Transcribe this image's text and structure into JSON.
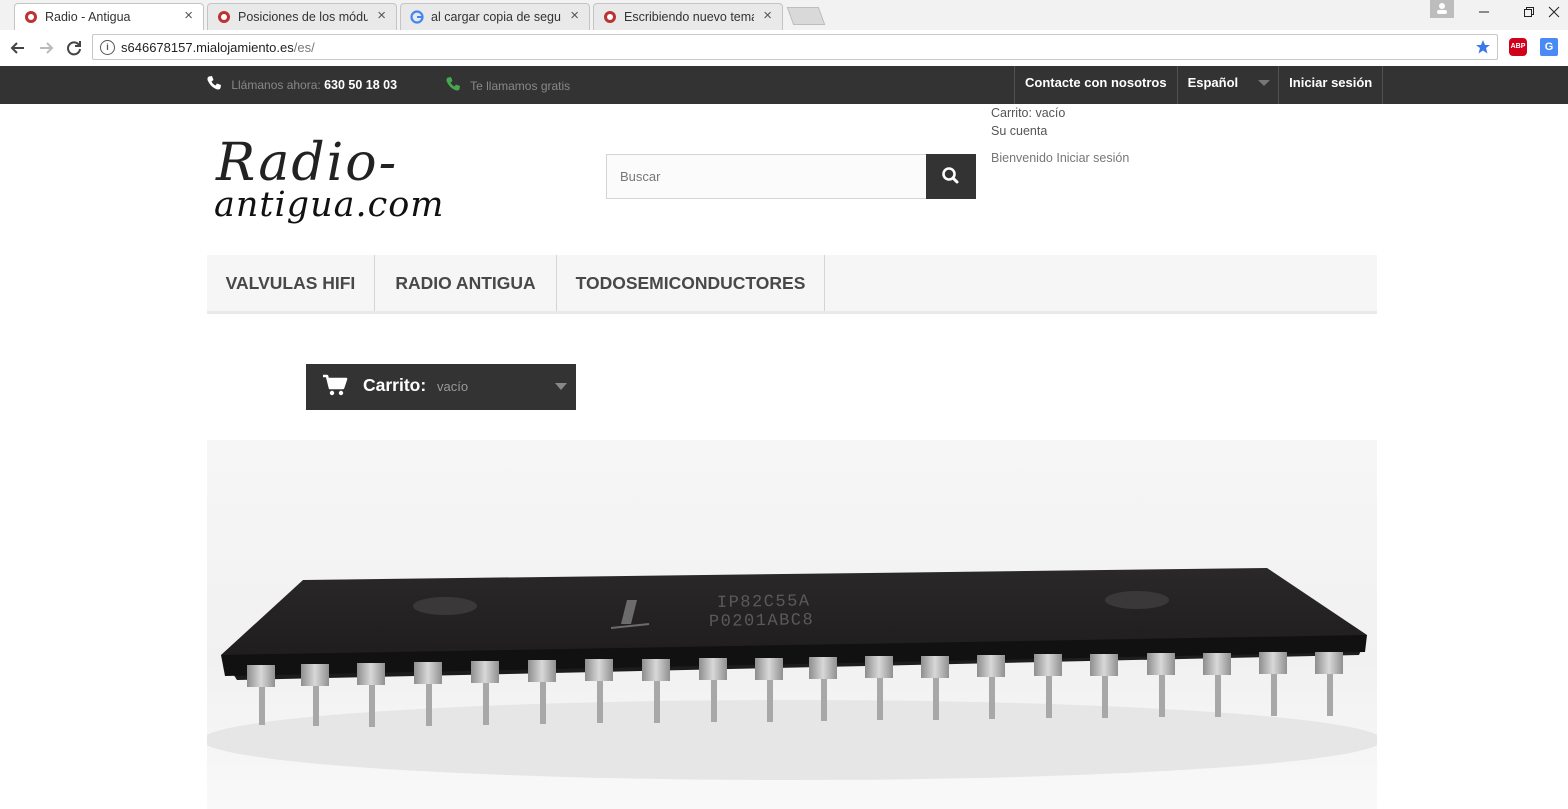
{
  "browser": {
    "tabs": [
      {
        "title": "Radio - Antigua",
        "active": true
      },
      {
        "title": "Posiciones de los módulos"
      },
      {
        "title": "al cargar copia de seguridad"
      },
      {
        "title": "Escribiendo nuevo tema"
      }
    ],
    "close_glyph": "×",
    "url_host": "s646678157.mialojamiento.es",
    "url_path": "/es/",
    "extensions": {
      "adblock": "ABP",
      "translate": "G"
    }
  },
  "topnav": {
    "call_label": "Llámanos ahora:",
    "phone": "630 50 18 03",
    "free_call": "Te llamamos gratis",
    "contact": "Contacte con nosotros",
    "language": "Español",
    "login": "Iniciar sesión"
  },
  "header": {
    "logo_line1": "Radio-",
    "logo_line2": "antigua.com",
    "search_placeholder": "Buscar",
    "cart_text": "Carrito: vacío",
    "account": "Su cuenta",
    "welcome": "Bienvenido",
    "welcome_login": "Iniciar sesión"
  },
  "menu": {
    "items": [
      "VALVULAS HIFI",
      "RADIO ANTIGUA",
      "TODOSEMICONDUCTORES"
    ]
  },
  "cart_block": {
    "label": "Carrito:",
    "value": "vacío"
  },
  "slider": {
    "chip_line1": "IP82C55A",
    "chip_line2": "P0201ABC8"
  },
  "colors": {
    "topnav_bg": "#333333",
    "phone_green": "#46a74e",
    "menu_bg": "#f6f6f6",
    "chrome_blue": "#3b78e7"
  }
}
